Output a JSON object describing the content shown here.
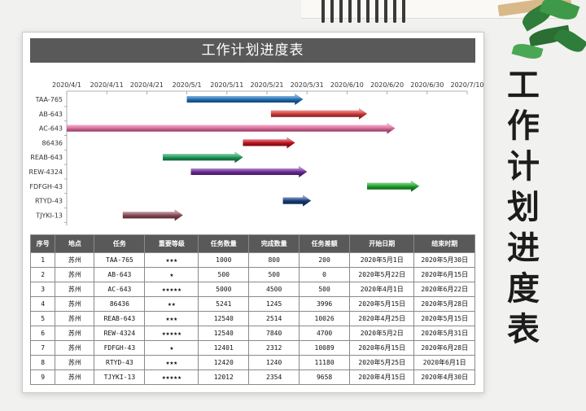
{
  "title": "工作计划进度表",
  "side_title_chars": [
    "工",
    "作",
    "计",
    "划",
    "进",
    "度",
    "表"
  ],
  "chart_data": {
    "type": "bar",
    "subtype": "gantt",
    "x_ticks": [
      "2020/4/1",
      "2020/4/11",
      "2020/4/21",
      "2020/5/1",
      "2020/5/11",
      "2020/5/21",
      "2020/5/31",
      "2020/6/10",
      "2020/6/20",
      "2020/6/30",
      "2020/7/10"
    ],
    "xlim": [
      "2020/4/1",
      "2020/7/10"
    ],
    "tasks": [
      {
        "name": "TAA-765",
        "start": "2020-05-01",
        "end": "2020-05-30",
        "color": "#1f6fb5"
      },
      {
        "name": "AB-643",
        "start": "2020-05-22",
        "end": "2020-06-15",
        "color": "#d23a3a"
      },
      {
        "name": "AC-643",
        "start": "2020-04-01",
        "end": "2020-06-22",
        "color": "#e06a9c"
      },
      {
        "name": "86436",
        "start": "2020-05-15",
        "end": "2020-05-28",
        "color": "#c0141e"
      },
      {
        "name": "REAB-643",
        "start": "2020-04-25",
        "end": "2020-05-15",
        "color": "#1f9a5a"
      },
      {
        "name": "REW-4324",
        "start": "2020-05-02",
        "end": "2020-05-31",
        "color": "#6c2a9a"
      },
      {
        "name": "FDFGH-43",
        "start": "2020-06-15",
        "end": "2020-06-28",
        "color": "#1ea32a"
      },
      {
        "name": "RTYD-43",
        "start": "2020-05-25",
        "end": "2020-06-01",
        "color": "#143f7c"
      },
      {
        "name": "TJYKI-13",
        "start": "2020-04-15",
        "end": "2020-04-30",
        "color": "#8a4a55"
      }
    ]
  },
  "table": {
    "headers": [
      "序号",
      "地点",
      "任务",
      "重要等级",
      "任务数量",
      "完成数量",
      "任务差额",
      "开始日期",
      "结束时期"
    ],
    "rows": [
      [
        "1",
        "苏州",
        "TAA-765",
        "★★★",
        "1000",
        "800",
        "200",
        "2020年5月1日",
        "2020年5月30日"
      ],
      [
        "2",
        "苏州",
        "AB-643",
        "★",
        "500",
        "500",
        "0",
        "2020年5月22日",
        "2020年6月15日"
      ],
      [
        "3",
        "苏州",
        "AC-643",
        "★★★★★",
        "5000",
        "4500",
        "500",
        "2020年4月1日",
        "2020年6月22日"
      ],
      [
        "4",
        "苏州",
        "86436",
        "★★",
        "5241",
        "1245",
        "3996",
        "2020年5月15日",
        "2020年5月28日"
      ],
      [
        "5",
        "苏州",
        "REAB-643",
        "★★★",
        "12540",
        "2514",
        "10026",
        "2020年4月25日",
        "2020年5月15日"
      ],
      [
        "6",
        "苏州",
        "REW-4324",
        "★★★★★",
        "12540",
        "7840",
        "4700",
        "2020年5月2日",
        "2020年5月31日"
      ],
      [
        "7",
        "苏州",
        "FDFGH-43",
        "★",
        "12401",
        "2312",
        "10089",
        "2020年6月15日",
        "2020年6月28日"
      ],
      [
        "8",
        "苏州",
        "RTYD-43",
        "★★★",
        "12420",
        "1240",
        "11180",
        "2020年5月25日",
        "2020年6月1日"
      ],
      [
        "9",
        "苏州",
        "TJYKI-13",
        "★★★★★",
        "12012",
        "2354",
        "9658",
        "2020年4月15日",
        "2020年4月30日"
      ]
    ]
  }
}
